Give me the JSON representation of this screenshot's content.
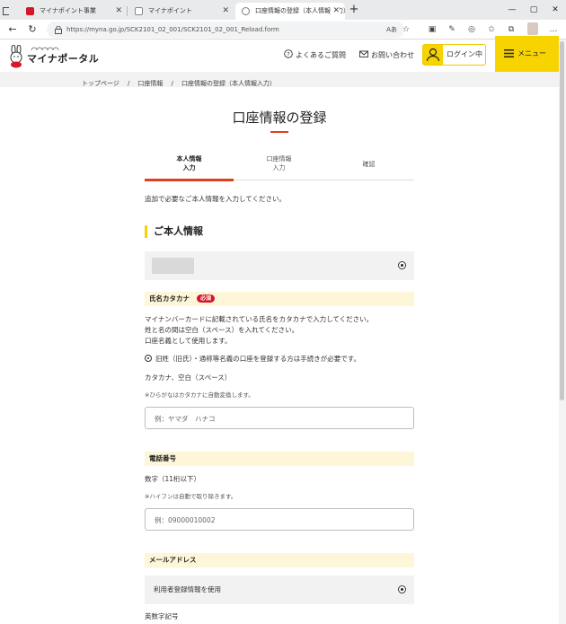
{
  "browser": {
    "tabs": [
      {
        "title": "マイナポイント事業",
        "favicon_color": "#d6162b"
      },
      {
        "title": "マイナポイント",
        "favicon_color": "#888888"
      },
      {
        "title": "口座情報の登録（本人情報入力）",
        "favicon_color": "#555555"
      }
    ],
    "new_tab": "+",
    "url": "https://myna.go.jp/SCK2101_02_001/SCK2101_02_001_Reload.form"
  },
  "header": {
    "logo_text": "マイナポータル",
    "faq_label": "よくあるご質問",
    "contact_label": "お問い合わせ",
    "login_label": "ログイン中",
    "menu_label": "メニュー"
  },
  "breadcrumb": {
    "items": [
      "トップページ",
      "口座情報",
      "口座情報の登録（本人情報入力）"
    ],
    "separator": "/"
  },
  "main": {
    "title": "口座情報の登録",
    "steps": [
      {
        "line1": "本人情報",
        "line2": "入力"
      },
      {
        "line1": "口座情報",
        "line2": "入力"
      },
      {
        "line1": "確認",
        "line2": ""
      }
    ],
    "lead": "追加で必要なご本人情報を入力してください。",
    "section_title": "ご本人情報",
    "name_field": {
      "label": "氏名カタカナ",
      "required_badge": "必須",
      "desc_line1": "マイナンバーカードに記載されている氏名をカタカナで入力してください。",
      "desc_line2": "姓と名の間は空白（スペース）を入れてください。",
      "desc_line3": "口座名義として使用します。",
      "info_line": "旧姓（旧氏）・通称等名義の口座を登録する方は手続きが必要です。",
      "format": "カタカナ、空白（スペース）",
      "note": "※ひらがなはカタカナに自動変換します。",
      "placeholder": "例：ヤマダ　ハナコ"
    },
    "phone_field": {
      "label": "電話番号",
      "format": "数字（11桁以下）",
      "note": "※ハイフンは自動で取り除きます。",
      "placeholder": "例：09000010002"
    },
    "email_field": {
      "label": "メールアドレス",
      "option_label": "利用者登録情報を使用",
      "format": "英数字記号"
    }
  },
  "colors": {
    "accent": "#f7d300",
    "brand_red": "#e04020",
    "required": "#d6162b"
  }
}
